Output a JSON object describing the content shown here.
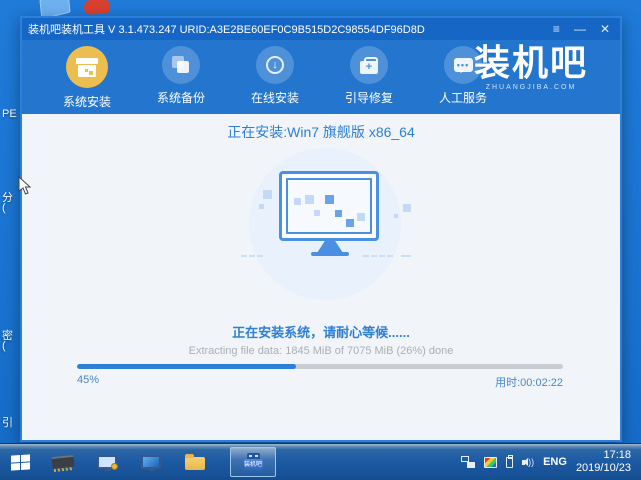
{
  "desktop": {
    "fragments": [
      {
        "text": "PE"
      },
      {
        "text": "分"
      },
      {
        "text": "("
      },
      {
        "text": "密"
      },
      {
        "text": "("
      },
      {
        "text": "引"
      }
    ]
  },
  "window": {
    "title": "装机吧装机工具 V 3.1.473.247 URID:A3E2BE60EF0C9B515D2C98554DF96D8D",
    "controls": {
      "menu": "≡",
      "minimize": "—",
      "close": "✕"
    },
    "nav": {
      "items": [
        {
          "label": "系统安装",
          "icon": "package-box-icon",
          "active": true
        },
        {
          "label": "系统备份",
          "icon": "backup-copies-icon",
          "active": false
        },
        {
          "label": "在线安装",
          "icon": "download-circle-icon",
          "active": false
        },
        {
          "label": "引导修复",
          "icon": "repair-toolbox-icon",
          "active": false
        },
        {
          "label": "人工服务",
          "icon": "chat-bubble-icon",
          "active": false
        }
      ],
      "logo": {
        "wordmark": "装机吧",
        "subtitle": "ZHUANGJIBA.COM"
      }
    },
    "main": {
      "installing_title": "正在安装:Win7 旗舰版 x86_64",
      "status_cn": "正在安装系统，请耐心等候......",
      "status_en": "Extracting file data: 1845 MiB of 7075 MiB (26%) done",
      "progress": {
        "percent_label": "45%",
        "percent_value": 45,
        "elapsed_label": "用时:00:02:22"
      }
    }
  },
  "taskbar": {
    "icons": [
      {
        "name": "start-button"
      },
      {
        "name": "memory-chip"
      },
      {
        "name": "computer-key"
      },
      {
        "name": "computer-display"
      },
      {
        "name": "file-folder"
      },
      {
        "name": "usb-installer",
        "label": "装机吧",
        "active": true
      }
    ],
    "tray": {
      "language": "ENG",
      "time": "17:18",
      "date": "2019/10/23"
    }
  },
  "colors": {
    "desktop": "#1a75d2",
    "titlebar": "#1566c5",
    "nav": "#2375cd",
    "accent_text": "#2e7fd6",
    "gold_circle": "#ecbe4f",
    "nav_circle": "#4e91d9",
    "content_bg": "#f1f4f8",
    "progress_fill": "#2e7fd8",
    "progress_track": "#c9cdd2",
    "taskbar": "#1d5ba5"
  }
}
